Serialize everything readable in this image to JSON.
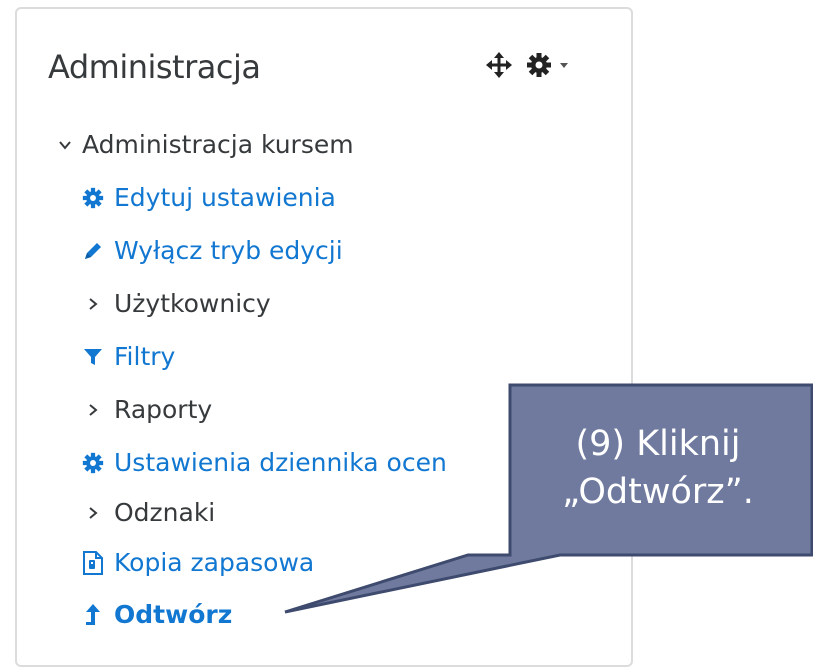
{
  "block": {
    "title": "Administracja",
    "controls": [
      "move-icon",
      "gear-icon",
      "caret-down-icon"
    ]
  },
  "tree": {
    "root": {
      "label": "Administracja kursem",
      "expanded": true
    },
    "items": [
      {
        "label": "Edytuj ustawienia",
        "icon": "gear-icon",
        "type": "link"
      },
      {
        "label": "Wyłącz tryb edycji",
        "icon": "pencil-icon",
        "type": "link"
      },
      {
        "label": "Użytkownicy",
        "icon": "chevron-right-icon",
        "type": "branch"
      },
      {
        "label": "Filtry",
        "icon": "filter-icon",
        "type": "link"
      },
      {
        "label": "Raporty",
        "icon": "chevron-right-icon",
        "type": "branch"
      },
      {
        "label": "Ustawienia dziennika ocen",
        "icon": "gear-icon",
        "type": "link"
      },
      {
        "label": "Odznaki",
        "icon": "chevron-right-icon",
        "type": "branch"
      },
      {
        "label": "Kopia zapasowa",
        "icon": "backup-file-icon",
        "type": "link"
      },
      {
        "label": "Odtwórz",
        "icon": "upload-arrow-icon",
        "type": "link-active"
      }
    ]
  },
  "callout": {
    "line1": "(9) Kliknij",
    "line2": "„Odtwórz”.",
    "fill": "#6f7a9e",
    "border": "#3e4a6e"
  },
  "colors": {
    "link": "#1177d1",
    "text": "#373a3c"
  }
}
